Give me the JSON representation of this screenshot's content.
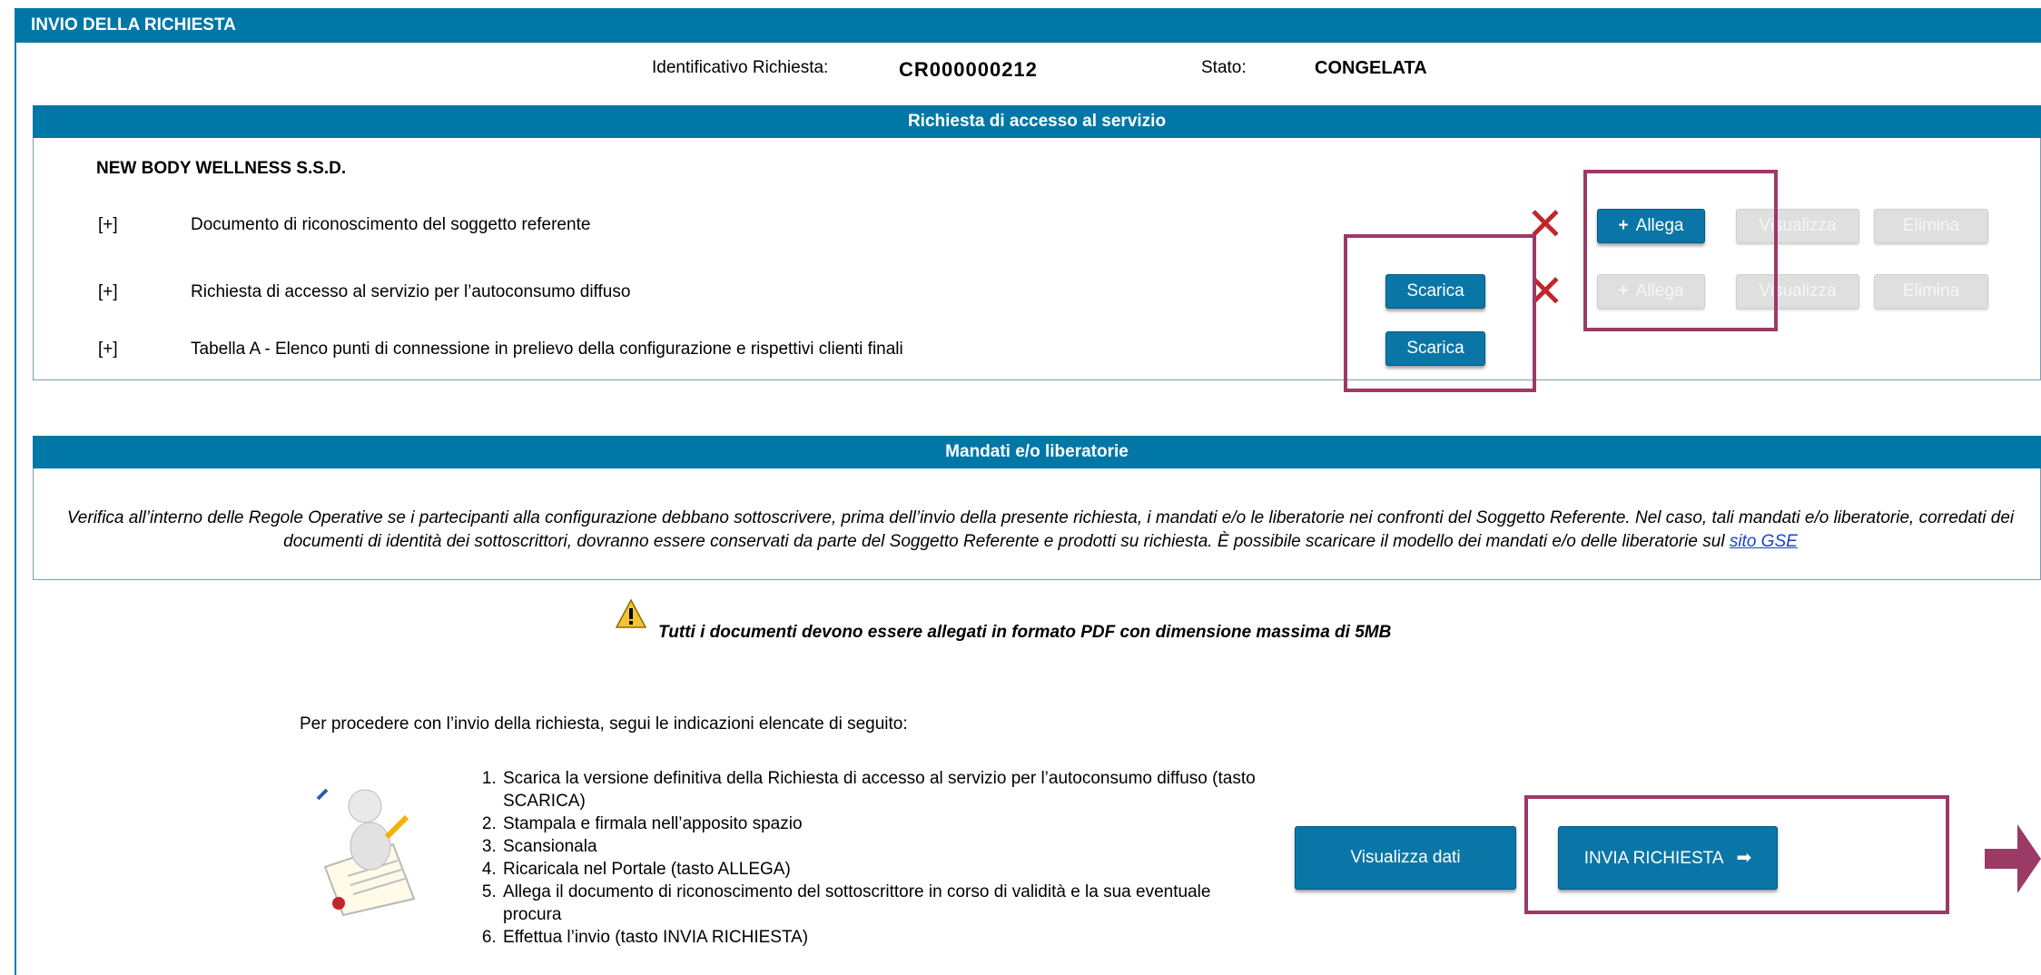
{
  "header": {
    "title": "INVIO DELLA RICHIESTA"
  },
  "info": {
    "id_label": "Identificativo Richiesta:",
    "id_value": "CR000000212",
    "state_label": "Stato:",
    "state_value": "CONGELATA"
  },
  "access_section": {
    "title": "Richiesta di accesso al servizio",
    "company": "NEW BODY WELLNESS S.S.D.",
    "rows": [
      {
        "toggle": "[+]",
        "label": "Documento di riconoscimento del soggetto referente"
      },
      {
        "toggle": "[+]",
        "label": "Richiesta di accesso al servizio per l’autoconsumo diffuso"
      },
      {
        "toggle": "[+]",
        "label": "Tabella A - Elenco punti di connessione in prelievo della configurazione e rispettivi clienti finali"
      }
    ],
    "buttons": {
      "scarica": "Scarica",
      "allega": "Allega",
      "visualizza": "Visualizza",
      "elimina": "Elimina"
    },
    "icons": {
      "missing": "x-mark-icon",
      "plus": "plus-icon"
    }
  },
  "mandati_section": {
    "title": "Mandati e/o liberatorie",
    "text": "Verifica all’interno delle Regole Operative se i partecipanti alla configurazione debbano sottoscrivere, prima dell’invio della presente richiesta, i mandati e/o le liberatorie nei confronti del Soggetto Referente. Nel caso, tali mandati e/o liberatorie, corredati dei documenti di identità dei sottoscrittori, dovranno essere conservati da parte del Soggetto Referente e prodotti su richiesta. È possibile scaricare il modello dei mandati e/o delle liberatorie sul",
    "link": "sito GSE"
  },
  "warning": {
    "icon": "warning-icon",
    "text": "Tutti i documenti devono essere allegati in formato PDF con dimensione massima di 5MB"
  },
  "instructions": {
    "intro": "Per procedere con l’invio della richiesta, segui le indicazioni elencate di seguito:",
    "steps": [
      "Scarica la versione definitiva della Richiesta di accesso al servizio per l’autoconsumo diffuso (tasto SCARICA)",
      "Stampala e firmala nell’apposito spazio",
      "Scansionala",
      "Ricaricala nel Portale (tasto ALLEGA)",
      "Allega il documento di riconoscimento del sottoscrittore in corso di validità e la sua eventuale procura",
      "Effettua l’invio (tasto INVIA RICHIESTA)"
    ],
    "illustration": "signing-document-illustration"
  },
  "actions": {
    "view_data": "Visualizza dati",
    "send": "INVIA RICHIESTA",
    "send_icon": "arrow-right-icon"
  },
  "colors": {
    "header": "#0077a6",
    "highlight": "#9c3a66",
    "error": "#c0262c"
  }
}
